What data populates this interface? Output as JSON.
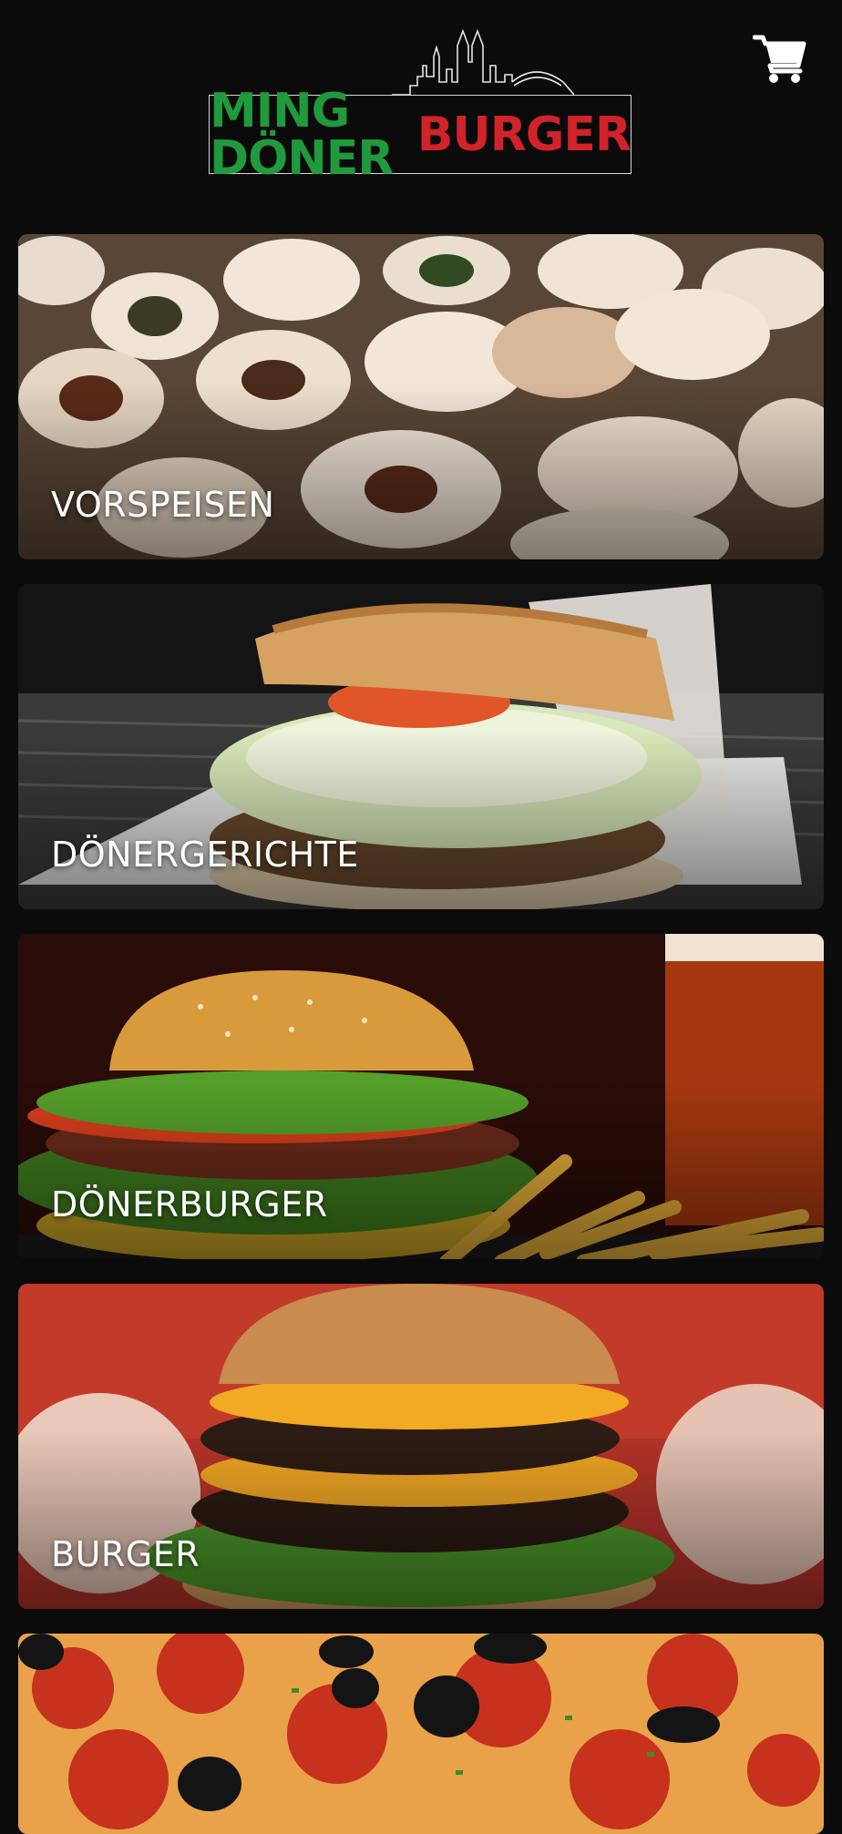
{
  "brand": {
    "logo_part1": "MING DÖNER",
    "logo_part2": "BURGER"
  },
  "header": {
    "cart_icon": "shopping-cart-icon"
  },
  "categories": [
    {
      "label": "VORSPEISEN"
    },
    {
      "label": "DÖNERGERICHTE"
    },
    {
      "label": "DÖNERBURGER"
    },
    {
      "label": "BURGER"
    },
    {
      "label": ""
    }
  ]
}
